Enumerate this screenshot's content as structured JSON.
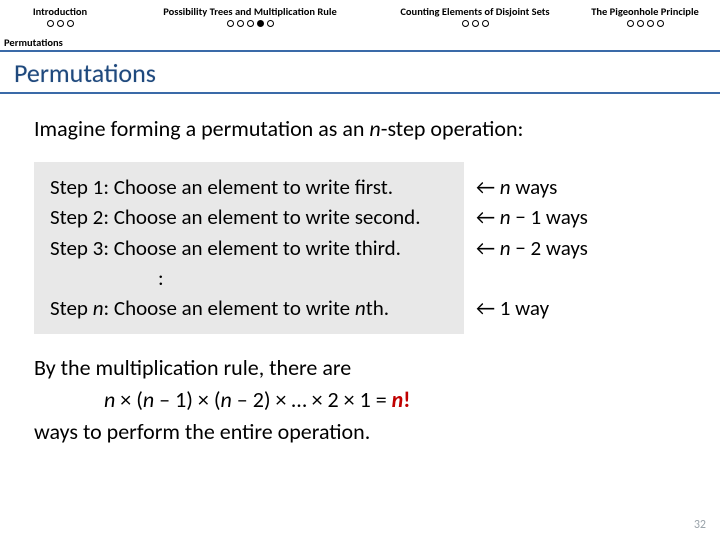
{
  "nav": {
    "items": [
      {
        "label": "Introduction",
        "dots": [
          0,
          0,
          0
        ]
      },
      {
        "label": "Possibility Trees and Multiplication Rule",
        "dots": [
          0,
          0,
          0,
          1,
          0
        ]
      },
      {
        "label": "Counting Elements of Disjoint Sets",
        "dots": [
          0,
          0,
          0
        ]
      },
      {
        "label": "The Pigeonhole Principle",
        "dots": [
          0,
          0,
          0,
          0
        ]
      }
    ]
  },
  "subnav": {
    "label": "Permutations"
  },
  "title": "Permutations",
  "intro_a": "Imagine forming a permutation as an ",
  "intro_n": "n",
  "intro_b": "-step operation:",
  "steps": [
    {
      "label": "Step 1: Choose an element to write first."
    },
    {
      "label": "Step 2: Choose an element to write second."
    },
    {
      "label": "Step 3: Choose an element to write third."
    }
  ],
  "step_last_a": "Step ",
  "step_last_n": "n",
  "step_last_b": ": Choose an element to write ",
  "step_last_c": "n",
  "step_last_d": "th.",
  "ways": {
    "w1_a": "← ",
    "w1_n": "n",
    "w1_b": " ways",
    "w2_a": "← ",
    "w2_n": "n",
    "w2_b": " − 1 ways",
    "w3_a": "← ",
    "w3_n": "n",
    "w3_b": " − 2 ways",
    "w4": "← 1 way"
  },
  "outro": {
    "l1": "By the multiplication rule, there are",
    "f_a": "n",
    "f_b": " × (",
    "f_c": "n",
    "f_d": " – 1) × (",
    "f_e": "n",
    "f_f": " – 2) × … × 2 × 1 = ",
    "f_g": "n",
    "f_h": "!",
    "l3": "ways to perform the entire operation."
  },
  "pagenum": "32",
  "colon": ":"
}
